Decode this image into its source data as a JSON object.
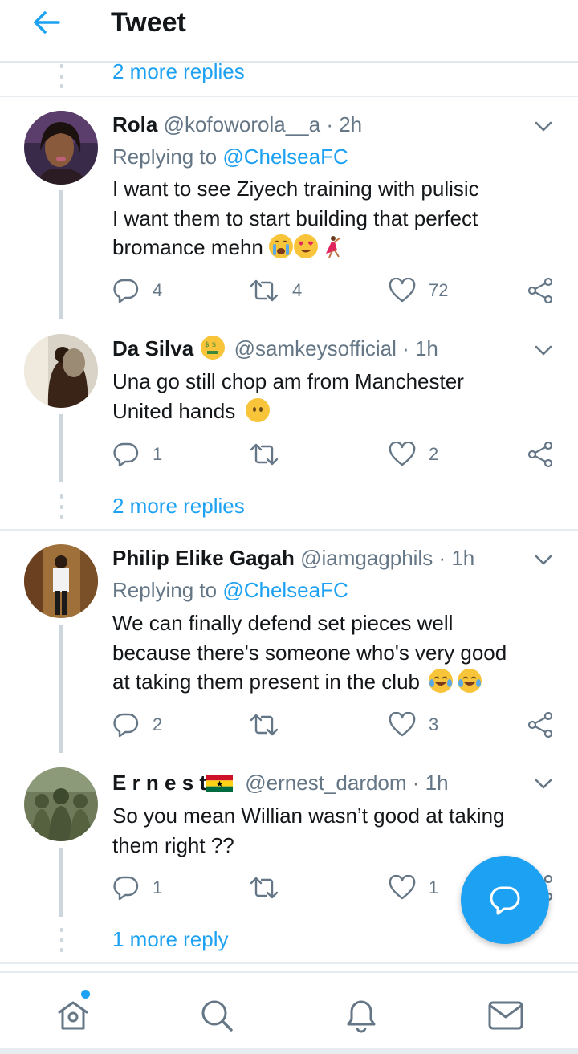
{
  "header": {
    "title": "Tweet"
  },
  "top_thread": {
    "more_replies": "2 more replies"
  },
  "tweets": [
    {
      "name": "Rola",
      "handle": "@kofoworola__a",
      "time": "· 2h",
      "replying_prefix": "Replying to",
      "replying_to": "@ChelseaFC",
      "lines": [
        "I want to see Ziyech training with pulisic",
        "I want them to start building that perfect",
        "bromance mehn"
      ],
      "reply_count": "4",
      "retweet_count": "4",
      "like_count": "72"
    },
    {
      "name": "Da Silva",
      "handle": "@samkeysofficial",
      "time": "· 1h",
      "lines": [
        "Una go still chop am from Manchester",
        "United hands"
      ],
      "reply_count": "1",
      "retweet_count": "",
      "like_count": "2",
      "more_replies": "2 more replies"
    },
    {
      "name": "Philip Elike Gagah",
      "handle": "@iamgagphils",
      "time": "· 1h",
      "replying_prefix": "Replying to",
      "replying_to": "@ChelseaFC",
      "lines": [
        "We can finally defend set pieces well",
        "because there's someone who's very good",
        "at taking them present in the club"
      ],
      "reply_count": "2",
      "retweet_count": "",
      "like_count": "3"
    },
    {
      "name": "E r n e s t",
      "handle": "@ernest_dardom",
      "time": "· 1h",
      "lines": [
        "So you mean Willian wasn’t good at taking",
        "them right ??"
      ],
      "reply_count": "1",
      "retweet_count": "",
      "like_count": "1",
      "more_replies": "1 more reply"
    }
  ],
  "icons": {
    "back": "arrow-left-icon",
    "chevron": "chevron-down-icon",
    "reply": "reply-icon",
    "retweet": "retweet-icon",
    "like": "heart-icon",
    "share": "share-icon",
    "compose": "compose-reply-icon",
    "nav": [
      "home-icon",
      "search-icon",
      "notifications-icon",
      "messages-icon"
    ]
  },
  "colors": {
    "accent": "#1da1f2",
    "text": "#14171a",
    "muted": "#657786",
    "border": "#e6ecf0"
  }
}
